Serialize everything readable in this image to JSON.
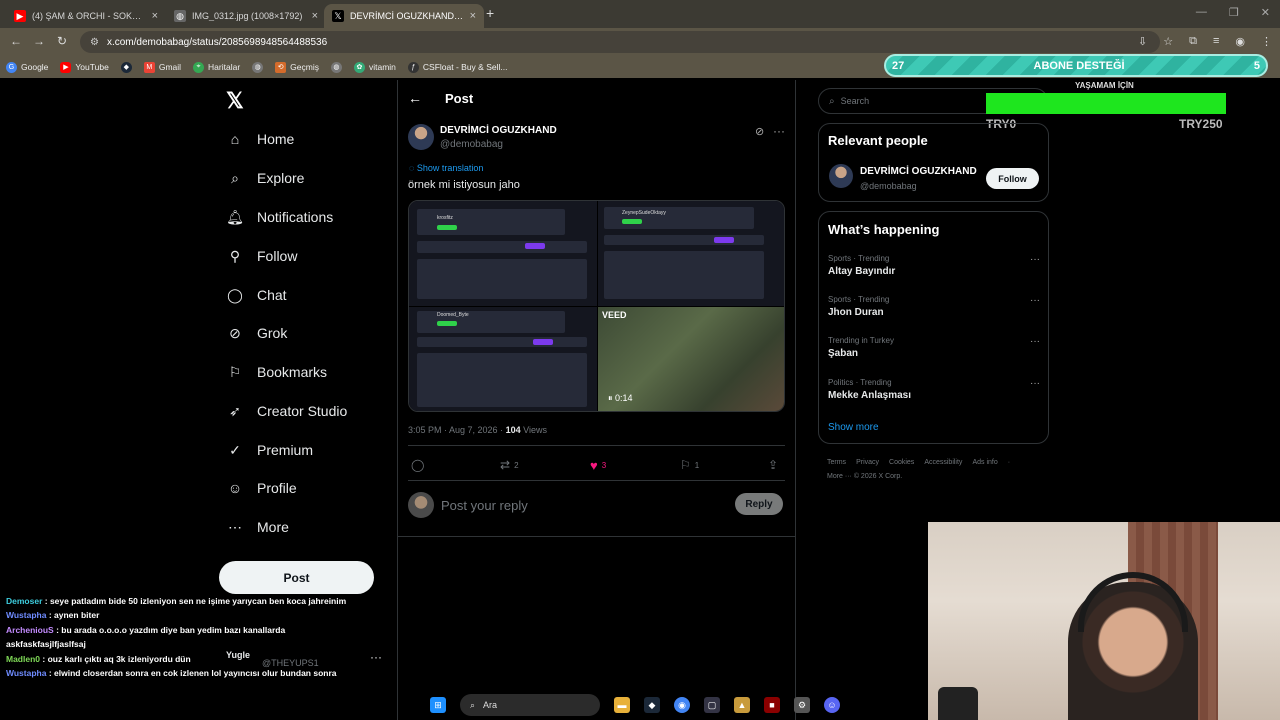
{
  "browser": {
    "tabs": [
      {
        "title": "(4) ŞAM & ORCHI - SOKAĞIN F",
        "icon": "youtube-icon",
        "color": "#ff0000"
      },
      {
        "title": "IMG_0312.jpg (1008×1792)",
        "icon": "globe-icon",
        "color": "#888888"
      },
      {
        "title": "DEVRİMCİ OGUZKHAND on X:",
        "icon": "x-icon",
        "color": "#000000"
      }
    ],
    "url": "x.com/demobabag/status/2085698948564488536",
    "bookmarks": [
      "Google",
      "YouTube",
      "",
      "Gmail",
      "Haritalar",
      "",
      "Geçmiş",
      "",
      "vitamin",
      "CSFloat - Buy & Sell..."
    ]
  },
  "nav": {
    "items": [
      {
        "label": "Home",
        "icon": "home-icon"
      },
      {
        "label": "Explore",
        "icon": "search-icon"
      },
      {
        "label": "Notifications",
        "icon": "bell-icon"
      },
      {
        "label": "Follow",
        "icon": "person-add-icon"
      },
      {
        "label": "Chat",
        "icon": "chat-icon"
      },
      {
        "label": "Grok",
        "icon": "grok-icon"
      },
      {
        "label": "Bookmarks",
        "icon": "bookmark-icon"
      },
      {
        "label": "Creator Studio",
        "icon": "rocket-icon"
      },
      {
        "label": "Premium",
        "icon": "verified-icon"
      },
      {
        "label": "Profile",
        "icon": "person-icon"
      },
      {
        "label": "More",
        "icon": "more-circle-icon"
      }
    ],
    "post_button": "Post",
    "side_user_name": "Yugle",
    "side_user_handle": "@THEYUPS1"
  },
  "post": {
    "header": "Post",
    "author": "DEVRİMCİ OGUZKHAND",
    "handle": "@demobabag",
    "show_translation": "Show translation",
    "text": "örnek mi istiyosun jaho",
    "media": {
      "panels": [
        "krosfitz",
        "ZeynepSudeOktayy",
        "Doomed_Byte"
      ],
      "video_badge": "VEED",
      "video_time": "0:14"
    },
    "timestamp": "3:05 PM · Aug 7, 2026 ·",
    "views": "104",
    "views_label": "Views",
    "actions": {
      "replies": "",
      "reposts": "2",
      "likes": "3",
      "bookmarks": "1"
    },
    "reply_placeholder": "Post your reply",
    "reply_button": "Reply"
  },
  "sidebar": {
    "search_placeholder": "Search",
    "relevant_title": "Relevant people",
    "relevant_name": "DEVRİMCİ OGUZKHAND",
    "relevant_handle": "@demobabag",
    "follow_label": "Follow",
    "happening_title": "What’s happening",
    "trends": [
      {
        "category": "Sports · Trending",
        "name": "Altay Bayındır"
      },
      {
        "category": "Sports · Trending",
        "name": "Jhon Duran"
      },
      {
        "category": "Trending in Turkey",
        "name": "Şaban"
      },
      {
        "category": "Politics · Trending",
        "name": "Mekke Anlaşması"
      }
    ],
    "show_more": "Show more",
    "footer_links": [
      "Terms",
      "Privacy",
      "Cookies",
      "Accessibility",
      "Ads info",
      "·"
    ],
    "footer_copyright": "More ···   © 2026 X Corp."
  },
  "overlay": {
    "donation_left": "27",
    "donation_title": "ABONE DESTEĞİ",
    "donation_right": "5",
    "goal_label": "YAŞAMAM İÇİN",
    "goal_min": "TRY0",
    "goal_max": "TRY250",
    "goal_progress": 1.0,
    "accent_color": "#1ee61e"
  },
  "chat": [
    {
      "user": "Demoser",
      "color": "#3ecfe0",
      "text": ": seye patladım bide 50 izleniyon sen ne işime yarıycan ben koca jahreinim"
    },
    {
      "user": "Wustapha",
      "color": "#6f8cff",
      "text": ": aynen biter"
    },
    {
      "user": "ArcheniouS",
      "color": "#c48cff",
      "text": ": bu arada o.o.o.o yazdım diye ban yedim bazı kanallarda askfaskfasjlfjaslfsaj"
    },
    {
      "user": "Madlen0",
      "color": "#7fd957",
      "text": ": ouz karlı çıktı aq 3k izleniyordu dün"
    },
    {
      "user": "Wustapha",
      "color": "#6f8cff",
      "text": ": elwind closerdan sonra en cok izlenen lol yayıncısı olur bundan sonra"
    }
  ],
  "taskbar": {
    "search_label": "Ara"
  }
}
